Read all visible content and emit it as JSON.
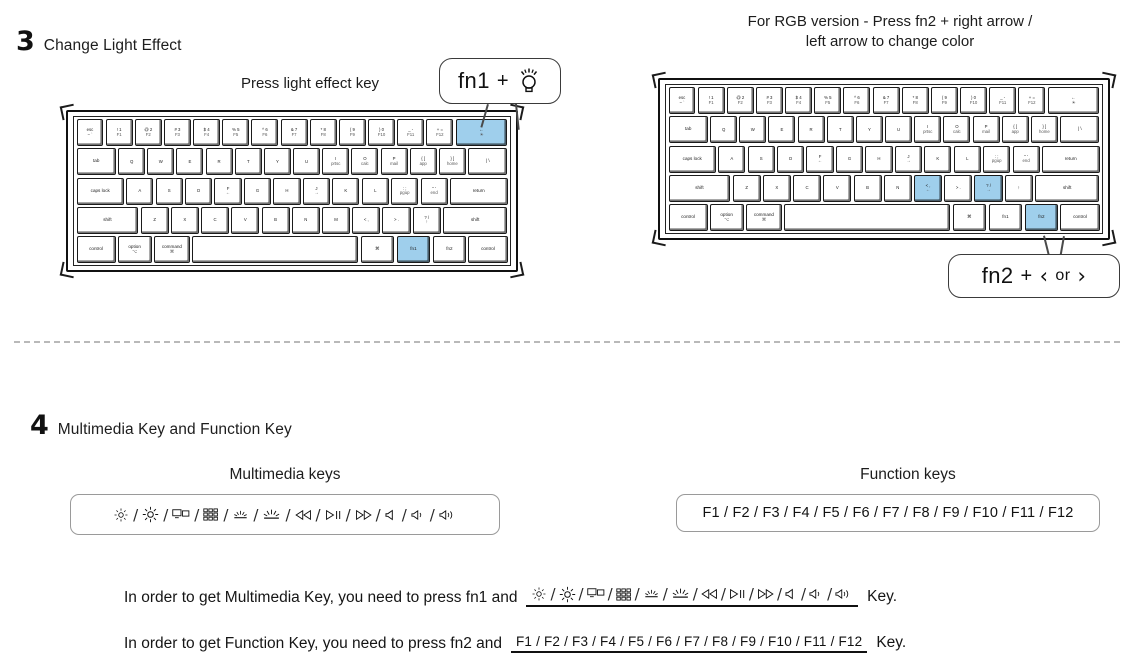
{
  "steps": [
    {
      "number": "3",
      "title": "Change Light Effect"
    },
    {
      "number": "4",
      "title": "Multimedia Key and Function Key"
    }
  ],
  "section3": {
    "left_caption": "Press light effect key",
    "right_note_line1": "For RGB version - Press fn2 + right arrow /",
    "right_note_line2": "left arrow to change color",
    "callout_fn1": {
      "key": "fn1",
      "plus": "+",
      "icon": "light-bulb-icon"
    },
    "callout_fn2": {
      "key": "fn2",
      "plus": "+",
      "left_arrow": "‹",
      "or": "or",
      "right_arrow": "›"
    },
    "left_keyboard": {
      "name": "60-percent-keyboard-light-effect",
      "highlighted_keys": [
        "backspace-light-effect",
        "fn1"
      ],
      "rows": [
        [
          {
            "top": "esc",
            "bot": "~ `",
            "w": 1
          },
          {
            "top": "! 1",
            "bot": "F1",
            "w": 1
          },
          {
            "top": "@ 2",
            "bot": "F2",
            "w": 1
          },
          {
            "top": "# 3",
            "bot": "F3",
            "w": 1
          },
          {
            "top": "$ 4",
            "bot": "F4",
            "w": 1
          },
          {
            "top": "% 5",
            "bot": "F5",
            "w": 1
          },
          {
            "top": "^ 6",
            "bot": "F6",
            "w": 1
          },
          {
            "top": "& 7",
            "bot": "F7",
            "w": 1
          },
          {
            "top": "* 8",
            "bot": "F8",
            "w": 1
          },
          {
            "top": "( 9",
            "bot": "F9",
            "w": 1
          },
          {
            "top": ") 0",
            "bot": "F10",
            "w": 1
          },
          {
            "top": "_ -",
            "bot": "F11",
            "w": 1
          },
          {
            "top": "+ =",
            "bot": "F12",
            "w": 1
          },
          {
            "top": "←",
            "bot": "☀",
            "w": 2,
            "hl": true,
            "name": "backspace-light-effect"
          }
        ],
        [
          {
            "top": "tab",
            "bot": "",
            "w": 1.5,
            "lbl": true
          },
          {
            "top": "Q",
            "bot": "",
            "w": 1
          },
          {
            "top": "W",
            "bot": "",
            "w": 1
          },
          {
            "top": "E",
            "bot": "",
            "w": 1
          },
          {
            "top": "R",
            "bot": "",
            "w": 1
          },
          {
            "top": "T",
            "bot": "",
            "w": 1
          },
          {
            "top": "Y",
            "bot": "",
            "w": 1
          },
          {
            "top": "U",
            "bot": "",
            "w": 1
          },
          {
            "top": "I",
            "bot": "prtsc",
            "w": 1
          },
          {
            "top": "O",
            "bot": "calc",
            "w": 1
          },
          {
            "top": "P",
            "bot": "mail",
            "w": 1
          },
          {
            "top": "{ [",
            "bot": "app",
            "w": 1
          },
          {
            "top": "} ]",
            "bot": "home",
            "w": 1
          },
          {
            "top": "| \\",
            "bot": "",
            "w": 1.5,
            "lbl": true
          }
        ],
        [
          {
            "top": "caps lock",
            "bot": "",
            "w": 1.8,
            "lbl": true
          },
          {
            "top": "A",
            "bot": "",
            "w": 1
          },
          {
            "top": "S",
            "bot": "",
            "w": 1
          },
          {
            "top": "D",
            "bot": "",
            "w": 1
          },
          {
            "top": "F",
            "bot": "←",
            "w": 1
          },
          {
            "top": "G",
            "bot": "",
            "w": 1
          },
          {
            "top": "H",
            "bot": "",
            "w": 1
          },
          {
            "top": "J",
            "bot": "→",
            "w": 1
          },
          {
            "top": "K",
            "bot": "",
            "w": 1
          },
          {
            "top": "L",
            "bot": "",
            "w": 1
          },
          {
            "top": ": ;",
            "bot": "pgup",
            "w": 1
          },
          {
            "top": "\" '",
            "bot": "end",
            "w": 1
          },
          {
            "top": "return",
            "bot": "",
            "w": 2.2,
            "lbl": true
          }
        ],
        [
          {
            "top": "shift",
            "bot": "",
            "w": 2.3,
            "lbl": true
          },
          {
            "top": "Z",
            "bot": "",
            "w": 1
          },
          {
            "top": "X",
            "bot": "",
            "w": 1
          },
          {
            "top": "C",
            "bot": "",
            "w": 1
          },
          {
            "top": "V",
            "bot": "",
            "w": 1
          },
          {
            "top": "B",
            "bot": "",
            "w": 1
          },
          {
            "top": "N",
            "bot": "",
            "w": 1
          },
          {
            "top": "M",
            "bot": "",
            "w": 1
          },
          {
            "top": "< ,",
            "bot": "",
            "w": 1
          },
          {
            "top": "> .",
            "bot": "",
            "w": 1
          },
          {
            "top": "? /",
            "bot": "↑",
            "w": 1
          },
          {
            "top": "shift",
            "bot": "",
            "w": 2.4,
            "lbl": true
          }
        ],
        [
          {
            "top": "control",
            "bot": "",
            "w": 1.4,
            "lbl": true
          },
          {
            "top": "option",
            "bot": "⌥",
            "w": 1.2,
            "lbl": true
          },
          {
            "top": "command",
            "bot": "⌘",
            "w": 1.3,
            "lbl": true
          },
          {
            "top": "",
            "bot": "",
            "w": 6.2,
            "name": "spacebar"
          },
          {
            "top": "⌘",
            "bot": "",
            "w": 1.2,
            "lbl": true
          },
          {
            "top": "fn1",
            "bot": "",
            "w": 1.2,
            "lbl": true,
            "hl": true,
            "name": "fn1"
          },
          {
            "top": "fn2",
            "bot": "",
            "w": 1.2,
            "lbl": true
          },
          {
            "top": "control",
            "bot": "",
            "w": 1.4,
            "lbl": true
          }
        ]
      ]
    },
    "right_keyboard": {
      "name": "60-percent-keyboard-rgb-color",
      "highlighted_keys": [
        "comma-left-arrow",
        "period-right-arrow",
        "fn2"
      ],
      "rows": [
        [
          {
            "top": "esc",
            "bot": "~ `",
            "w": 1
          },
          {
            "top": "! 1",
            "bot": "F1",
            "w": 1
          },
          {
            "top": "@ 2",
            "bot": "F2",
            "w": 1
          },
          {
            "top": "# 3",
            "bot": "F3",
            "w": 1
          },
          {
            "top": "$ 4",
            "bot": "F4",
            "w": 1
          },
          {
            "top": "% 5",
            "bot": "F5",
            "w": 1
          },
          {
            "top": "^ 6",
            "bot": "F6",
            "w": 1
          },
          {
            "top": "& 7",
            "bot": "F7",
            "w": 1
          },
          {
            "top": "* 8",
            "bot": "F8",
            "w": 1
          },
          {
            "top": "( 9",
            "bot": "F9",
            "w": 1
          },
          {
            "top": ") 0",
            "bot": "F10",
            "w": 1
          },
          {
            "top": "_ -",
            "bot": "F11",
            "w": 1
          },
          {
            "top": "+ =",
            "bot": "F12",
            "w": 1
          },
          {
            "top": "←",
            "bot": "☀",
            "w": 2
          }
        ],
        [
          {
            "top": "tab",
            "bot": "",
            "w": 1.5,
            "lbl": true
          },
          {
            "top": "Q",
            "bot": "",
            "w": 1
          },
          {
            "top": "W",
            "bot": "",
            "w": 1
          },
          {
            "top": "E",
            "bot": "",
            "w": 1
          },
          {
            "top": "R",
            "bot": "",
            "w": 1
          },
          {
            "top": "T",
            "bot": "",
            "w": 1
          },
          {
            "top": "Y",
            "bot": "",
            "w": 1
          },
          {
            "top": "U",
            "bot": "",
            "w": 1
          },
          {
            "top": "I",
            "bot": "prtsc",
            "w": 1
          },
          {
            "top": "O",
            "bot": "calc",
            "w": 1
          },
          {
            "top": "P",
            "bot": "mail",
            "w": 1
          },
          {
            "top": "{ [",
            "bot": "app",
            "w": 1
          },
          {
            "top": "} ]",
            "bot": "home",
            "w": 1
          },
          {
            "top": "| \\",
            "bot": "",
            "w": 1.5,
            "lbl": true
          }
        ],
        [
          {
            "top": "caps lock",
            "bot": "",
            "w": 1.8,
            "lbl": true
          },
          {
            "top": "A",
            "bot": "",
            "w": 1
          },
          {
            "top": "S",
            "bot": "",
            "w": 1
          },
          {
            "top": "D",
            "bot": "",
            "w": 1
          },
          {
            "top": "F",
            "bot": "←",
            "w": 1
          },
          {
            "top": "G",
            "bot": "",
            "w": 1
          },
          {
            "top": "H",
            "bot": "",
            "w": 1
          },
          {
            "top": "J",
            "bot": "→",
            "w": 1
          },
          {
            "top": "K",
            "bot": "",
            "w": 1
          },
          {
            "top": "L",
            "bot": "",
            "w": 1
          },
          {
            "top": ": ;",
            "bot": "pgup",
            "w": 1
          },
          {
            "top": "\" '",
            "bot": "end",
            "w": 1
          },
          {
            "top": "return",
            "bot": "",
            "w": 2.2,
            "lbl": true
          }
        ],
        [
          {
            "top": "shift",
            "bot": "",
            "w": 2.3,
            "lbl": true
          },
          {
            "top": "Z",
            "bot": "",
            "w": 1
          },
          {
            "top": "X",
            "bot": "",
            "w": 1
          },
          {
            "top": "C",
            "bot": "",
            "w": 1
          },
          {
            "top": "V",
            "bot": "",
            "w": 1
          },
          {
            "top": "B",
            "bot": "",
            "w": 1
          },
          {
            "top": "N",
            "bot": "",
            "w": 1
          },
          {
            "top": "< ,",
            "bot": "←",
            "w": 1,
            "hl": true,
            "name": "comma-left-arrow"
          },
          {
            "top": "> .",
            "bot": "",
            "w": 1
          },
          {
            "top": "? /",
            "bot": "→",
            "w": 1,
            "hl": true,
            "name": "period-right-arrow"
          },
          {
            "top": "↑",
            "bot": "",
            "w": 1
          },
          {
            "top": "shift",
            "bot": "",
            "w": 2.4,
            "lbl": true
          }
        ],
        [
          {
            "top": "control",
            "bot": "",
            "w": 1.4,
            "lbl": true
          },
          {
            "top": "option",
            "bot": "⌥",
            "w": 1.2,
            "lbl": true
          },
          {
            "top": "command",
            "bot": "⌘",
            "w": 1.3,
            "lbl": true
          },
          {
            "top": "",
            "bot": "",
            "w": 6.2,
            "name": "spacebar"
          },
          {
            "top": "⌘",
            "bot": "",
            "w": 1.2,
            "lbl": true
          },
          {
            "top": "fn1",
            "bot": "",
            "w": 1.2,
            "lbl": true
          },
          {
            "top": "fn2",
            "bot": "",
            "w": 1.2,
            "lbl": true,
            "hl": true,
            "name": "fn2"
          },
          {
            "top": "control",
            "bot": "",
            "w": 1.4,
            "lbl": true
          }
        ]
      ]
    }
  },
  "section4": {
    "multimedia_caption": "Multimedia keys",
    "function_caption": "Function keys",
    "multimedia_keys": [
      {
        "icon": "brightness-down-icon",
        "label": "·☀·"
      },
      {
        "icon": "brightness-up-icon",
        "label": "☀"
      },
      {
        "icon": "display-switch-icon",
        "label": "❐▫"
      },
      {
        "icon": "apps-grid-icon",
        "label": "∷"
      },
      {
        "icon": "backlight-down-icon",
        "label": "⌵"
      },
      {
        "icon": "backlight-up-icon",
        "label": "⌵"
      },
      {
        "icon": "previous-track-icon",
        "label": "◁◁"
      },
      {
        "icon": "play-pause-icon",
        "label": "▷‖"
      },
      {
        "icon": "next-track-icon",
        "label": "▷▷"
      },
      {
        "icon": "mute-icon",
        "label": "◁"
      },
      {
        "icon": "volume-down-icon",
        "label": "◁)"
      },
      {
        "icon": "volume-up-icon",
        "label": "◁))"
      }
    ],
    "function_keys_text": "F1 / F2 / F3 / F4 / F5 / F6 / F7 / F8 / F9 / F10 / F11 / F12",
    "sentence_multimedia": {
      "lead": "In order to get Multimedia Key, you need to press fn1 and",
      "tail": "Key."
    },
    "sentence_function": {
      "lead": "In order to get Function Key, you need to press fn2 and",
      "tail": "Key."
    }
  },
  "colors": {
    "highlight_blue": "#9fcfec",
    "outline_black": "#111111",
    "divider_gray": "#b9b9b9",
    "box_border_gray": "#9a9a9a"
  }
}
